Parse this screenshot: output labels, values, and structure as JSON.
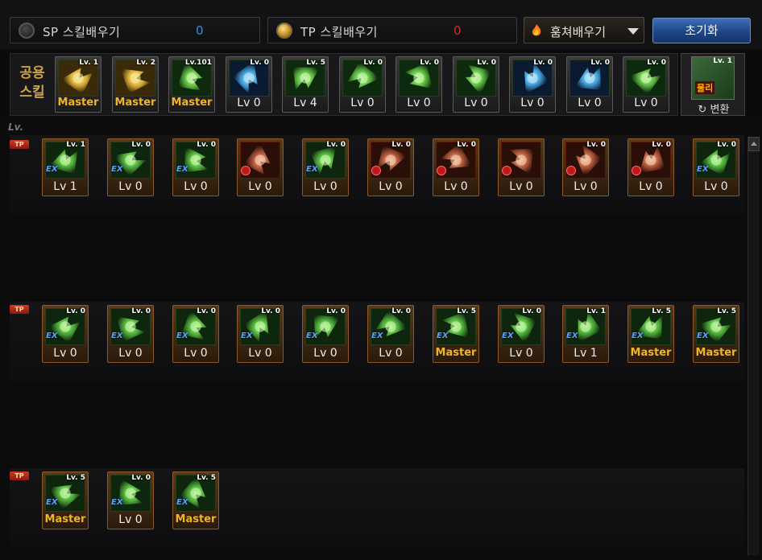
{
  "header": {
    "sp_label": "SP 스킬배우기",
    "sp_value": "0",
    "tp_label": "TP 스킬배우기",
    "tp_value": "0",
    "steal_label": "훔쳐배우기",
    "reset_label": "초기화"
  },
  "common": {
    "label_line1": "공용",
    "label_line2": "스킬",
    "convert_lv": "Lv. 1",
    "convert_tag": "물리",
    "convert_label": "변환",
    "skills": [
      {
        "lv": "Lv. 1",
        "level": "Master",
        "color": "gold"
      },
      {
        "lv": "Lv. 2",
        "level": "Master",
        "color": "gold"
      },
      {
        "lv": "Lv.101",
        "level": "Master",
        "color": "green"
      },
      {
        "lv": "Lv. 0",
        "level": "Lv 0",
        "color": "blue"
      },
      {
        "lv": "Lv. 5",
        "level": "Lv 4",
        "color": "green"
      },
      {
        "lv": "Lv. 0",
        "level": "Lv 0",
        "color": "green"
      },
      {
        "lv": "Lv. 0",
        "level": "Lv 0",
        "color": "green"
      },
      {
        "lv": "Lv. 0",
        "level": "Lv 0",
        "color": "green"
      },
      {
        "lv": "Lv. 0",
        "level": "Lv 0",
        "color": "blue"
      },
      {
        "lv": "Lv. 0",
        "level": "Lv 0",
        "color": "blue"
      },
      {
        "lv": "Lv. 0",
        "level": "Lv 0",
        "color": "green"
      }
    ]
  },
  "lv_header": "Lv.",
  "tp_marker": "TP",
  "rows": [
    {
      "skills": [
        {
          "lv": "Lv. 1",
          "level": "Lv 1",
          "type": "ex"
        },
        {
          "lv": "Lv. 0",
          "level": "Lv 0",
          "type": "ex"
        },
        {
          "lv": "Lv. 0",
          "level": "Lv 0",
          "type": "ex"
        },
        {
          "lv": "",
          "level": "Lv 0",
          "type": "locked"
        },
        {
          "lv": "Lv. 0",
          "level": "Lv 0",
          "type": "ex"
        },
        {
          "lv": "Lv. 0",
          "level": "Lv 0",
          "type": "locked"
        },
        {
          "lv": "Lv. 0",
          "level": "Lv 0",
          "type": "locked"
        },
        {
          "lv": "",
          "level": "Lv 0",
          "type": "locked"
        },
        {
          "lv": "Lv. 0",
          "level": "Lv 0",
          "type": "locked"
        },
        {
          "lv": "Lv. 0",
          "level": "Lv 0",
          "type": "locked"
        },
        {
          "lv": "Lv. 0",
          "level": "Lv 0",
          "type": "ex"
        }
      ]
    },
    {
      "skills": [
        {
          "lv": "Lv. 0",
          "level": "Lv 0",
          "type": "ex"
        },
        {
          "lv": "Lv. 0",
          "level": "Lv 0",
          "type": "ex"
        },
        {
          "lv": "Lv. 0",
          "level": "Lv 0",
          "type": "ex"
        },
        {
          "lv": "Lv. 0",
          "level": "Lv 0",
          "type": "ex"
        },
        {
          "lv": "Lv. 0",
          "level": "Lv 0",
          "type": "ex"
        },
        {
          "lv": "Lv. 0",
          "level": "Lv 0",
          "type": "ex"
        },
        {
          "lv": "Lv. 5",
          "level": "Master",
          "type": "ex"
        },
        {
          "lv": "Lv. 0",
          "level": "Lv 0",
          "type": "ex"
        },
        {
          "lv": "Lv. 1",
          "level": "Lv 1",
          "type": "ex"
        },
        {
          "lv": "Lv. 5",
          "level": "Master",
          "type": "ex"
        },
        {
          "lv": "Lv. 5",
          "level": "Master",
          "type": "ex"
        }
      ]
    },
    {
      "skills": [
        {
          "lv": "Lv. 5",
          "level": "Master",
          "type": "ex"
        },
        {
          "lv": "Lv. 0",
          "level": "Lv 0",
          "type": "ex"
        },
        {
          "lv": "Lv. 5",
          "level": "Master",
          "type": "ex"
        }
      ]
    }
  ],
  "colors": {
    "sp_value": "#3b8fd8",
    "tp_value": "#d03020",
    "master_text": "#f0b429",
    "reset_button": "#1f4587",
    "common_label": "#c9a44a"
  }
}
